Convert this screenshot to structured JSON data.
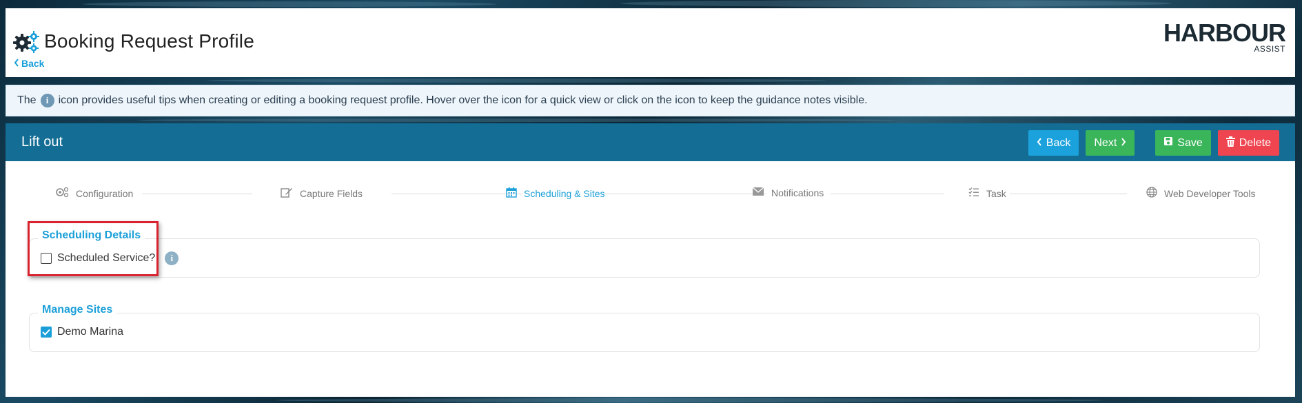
{
  "header": {
    "title": "Booking Request Profile",
    "back_label": "Back",
    "logo_main": "HARBOUR",
    "logo_sub": "ASSIST"
  },
  "tip": {
    "before": "The",
    "after": "icon provides useful tips when creating or editing a booking request profile. Hover over the icon for a quick view or click on the icon to keep the guidance notes visible."
  },
  "panel": {
    "title": "Lift out",
    "buttons": {
      "back": "Back",
      "next": "Next",
      "save": "Save",
      "delete": "Delete"
    }
  },
  "steps": [
    {
      "label": "Configuration",
      "icon": "gears-icon",
      "active": false
    },
    {
      "label": "Capture Fields",
      "icon": "edit-icon",
      "active": false
    },
    {
      "label": "Scheduling & Sites",
      "icon": "calendar-icon",
      "active": true
    },
    {
      "label": "Notifications",
      "icon": "envelope-icon",
      "active": false
    },
    {
      "label": "Task",
      "icon": "checklist-icon",
      "active": false
    },
    {
      "label": "Web Developer Tools",
      "icon": "globe-icon",
      "active": false
    }
  ],
  "scheduling": {
    "legend": "Scheduling Details",
    "scheduled_service_label": "Scheduled Service?",
    "scheduled_service_checked": false
  },
  "sites": {
    "legend": "Manage Sites",
    "items": [
      {
        "label": "Demo Marina",
        "checked": true
      }
    ]
  },
  "colors": {
    "panel_header": "#136d94",
    "accent": "#1b9fd8",
    "success": "#3ab55a",
    "danger": "#ee4550",
    "highlight": "#d9232f"
  }
}
